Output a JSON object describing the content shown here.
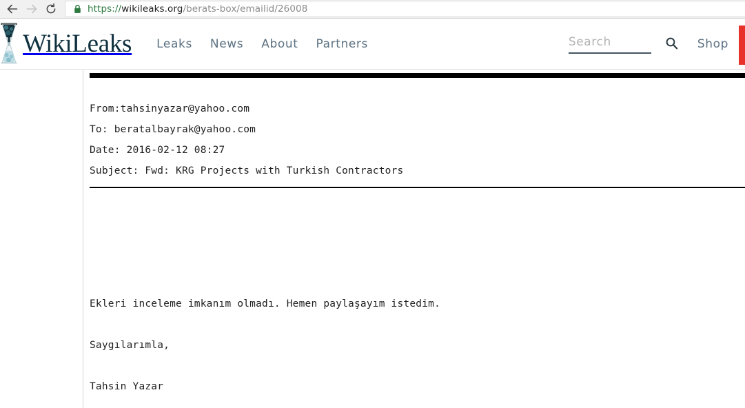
{
  "browser": {
    "back_label": "Back",
    "forward_label": "Forward",
    "reload_label": "Reload",
    "lock_icon": "padlock-secure-icon",
    "url_scheme": "https://",
    "url_host": "wikileaks.org",
    "url_path": "/berats-box/emailid/26008",
    "url_full": "https://wikileaks.org/berats-box/emailid/26008"
  },
  "header": {
    "logo_icon": "wikileaks-hourglass-logo",
    "wordmark": "WikiLeaks",
    "nav": [
      {
        "label": "Leaks"
      },
      {
        "label": "News"
      },
      {
        "label": "About"
      },
      {
        "label": "Partners"
      }
    ],
    "search": {
      "placeholder": "Search",
      "value": "",
      "icon": "search-icon"
    },
    "shop_label": "Shop",
    "donate_bar_color": "#e8312a"
  },
  "email": {
    "headers": [
      "From:tahsinyazar@yahoo.com",
      "To: beratalbayrak@yahoo.com",
      "Date: 2016-02-12 08:27",
      "Subject: Fwd: KRG Projects with Turkish Contractors"
    ],
    "from": "From:tahsinyazar@yahoo.com",
    "to": "To: beratalbayrak@yahoo.com",
    "date": "Date: 2016-02-12 08:27",
    "subject": "Subject: Fwd: KRG Projects with Turkish Contractors",
    "body": [
      "Ekleri inceleme imkanım olmadı. Hemen paylaşayım istedim.",
      "",
      "Saygılarımla,",
      "",
      "Tahsin Yazar"
    ],
    "body_line_1": "Ekleri inceleme imkanım olmadı. Hemen paylaşayım istedim.",
    "body_line_2": "Saygılarımla,",
    "body_line_3": "Tahsin Yazar"
  },
  "colors": {
    "nav_link": "#5d7282",
    "wordmark": "#10313f",
    "url_secure": "#2d7a3e",
    "donate": "#e8312a",
    "mono_text": "#222222"
  }
}
